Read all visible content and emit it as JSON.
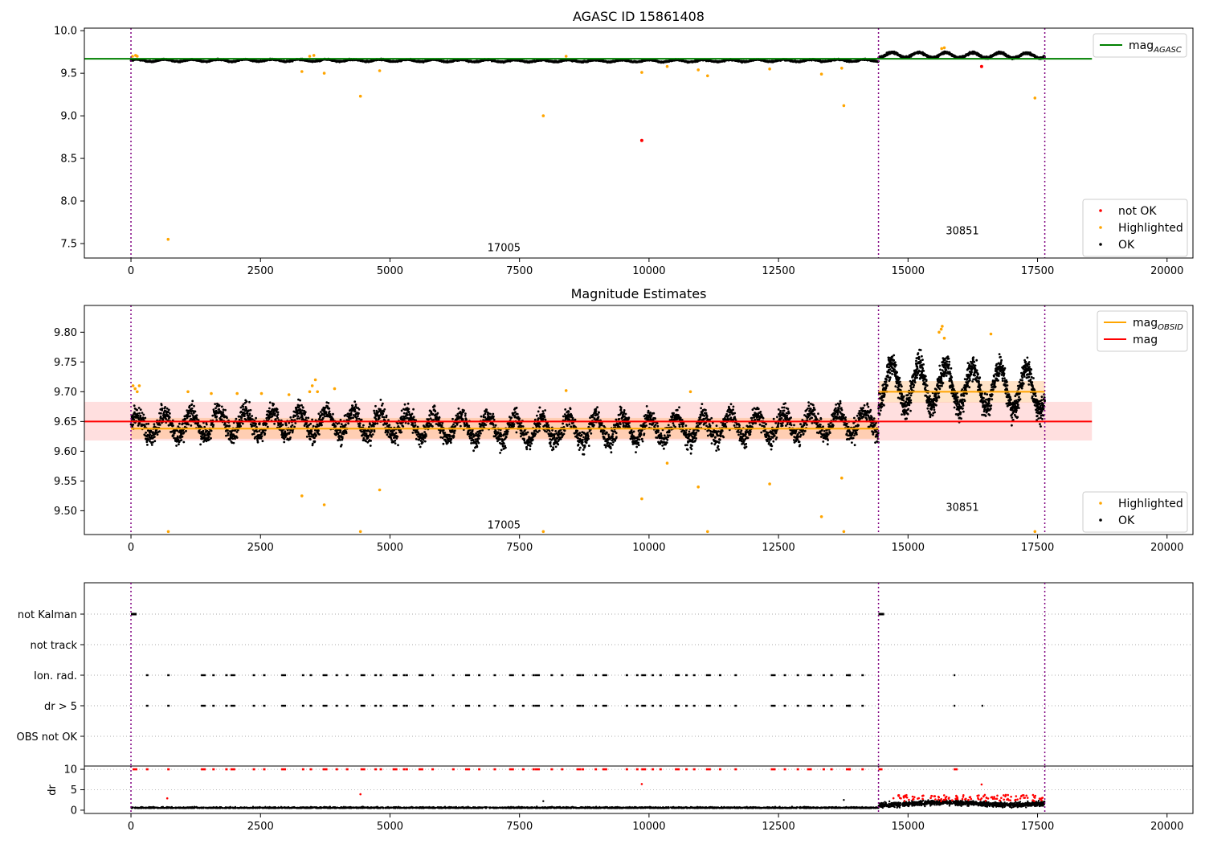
{
  "colors": {
    "ok": "#000000",
    "highlighted": "#ffa500",
    "not_ok": "#ff0000",
    "agasc_line": "#008000",
    "obsid_line": "#ffa500",
    "mag_line": "#ff0000",
    "boundary": "#800080",
    "band_red": "#ff8080",
    "band_orange": "#ffb060"
  },
  "chart_data": [
    {
      "type": "scatter",
      "title": "AGASC ID 15861408",
      "xlim": [
        -900,
        20500
      ],
      "ylim": [
        7.33,
        10.03
      ],
      "xticks": [
        0,
        2500,
        5000,
        7500,
        10000,
        12500,
        15000,
        17500,
        20000
      ],
      "yticks": [
        "7.5",
        "8.0",
        "8.5",
        "9.0",
        "9.5",
        "10.0"
      ],
      "ytick_values": [
        7.5,
        8.0,
        8.5,
        9.0,
        9.5,
        10.0
      ],
      "boundaries": [
        0,
        14430,
        17640
      ],
      "annotations": [
        {
          "text": "17005",
          "x": 7200,
          "y": 7.41
        },
        {
          "text": "30851",
          "x": 16050,
          "y": 7.61
        }
      ],
      "legend_top": [
        {
          "label": "mag",
          "sub": "AGASC",
          "kind": "line",
          "color": "#008000"
        }
      ],
      "legend_bottom": [
        {
          "label": "not OK",
          "color": "#ff0000"
        },
        {
          "label": "Highlighted",
          "color": "#ffa500"
        },
        {
          "label": "OK",
          "color": "#000000"
        }
      ],
      "reference_line": {
        "name": "mag_AGASC",
        "y": 9.67,
        "x": [
          -900,
          18550
        ]
      },
      "series": [
        {
          "name": "OK",
          "segments": [
            {
              "x": [
                0,
                14430
              ],
              "mean": 9.648,
              "amp": 0.012,
              "noise": 0.008
            },
            {
              "x": [
                14430,
                17640
              ],
              "mean": 9.705,
              "amp": 0.03,
              "noise": 0.012
            }
          ]
        },
        {
          "name": "Highlighted",
          "points": [
            [
              30,
              9.7
            ],
            [
              90,
              9.71
            ],
            [
              120,
              9.7
            ],
            [
              718,
              7.55
            ],
            [
              3300,
              9.52
            ],
            [
              3450,
              9.7
            ],
            [
              3530,
              9.71
            ],
            [
              3730,
              9.5
            ],
            [
              4430,
              9.23
            ],
            [
              4800,
              9.53
            ],
            [
              7960,
              9.0
            ],
            [
              8400,
              9.7
            ],
            [
              9860,
              9.51
            ],
            [
              10350,
              9.58
            ],
            [
              10950,
              9.54
            ],
            [
              11130,
              9.47
            ],
            [
              12330,
              9.55
            ],
            [
              13330,
              9.49
            ],
            [
              13720,
              9.56
            ],
            [
              13760,
              9.12
            ],
            [
              15650,
              9.79
            ],
            [
              15700,
              9.8
            ],
            [
              17450,
              9.21
            ]
          ]
        },
        {
          "name": "not OK",
          "points": [
            [
              9860,
              8.71
            ],
            [
              16420,
              9.58
            ]
          ]
        }
      ]
    },
    {
      "type": "scatter",
      "title": "Magnitude Estimates",
      "xlim": [
        -900,
        20500
      ],
      "ylim": [
        9.46,
        9.845
      ],
      "xticks": [
        0,
        2500,
        5000,
        7500,
        10000,
        12500,
        15000,
        17500,
        20000
      ],
      "yticks": [
        "9.50",
        "9.55",
        "9.60",
        "9.65",
        "9.70",
        "9.75",
        "9.80"
      ],
      "ytick_values": [
        9.5,
        9.55,
        9.6,
        9.65,
        9.7,
        9.75,
        9.8
      ],
      "boundaries": [
        0,
        14430,
        17640
      ],
      "annotations": [
        {
          "text": "17005",
          "x": 7200,
          "y": 9.47
        },
        {
          "text": "30851",
          "x": 16050,
          "y": 9.5
        }
      ],
      "legend_top": [
        {
          "label": "mag",
          "sub": "OBSID",
          "kind": "line",
          "color": "#ffa500"
        },
        {
          "label": "mag",
          "sub": "",
          "kind": "line",
          "color": "#ff0000"
        }
      ],
      "legend_bottom": [
        {
          "label": "Highlighted",
          "color": "#ffa500"
        },
        {
          "label": "OK",
          "color": "#000000"
        }
      ],
      "mag_line": {
        "y": 9.65,
        "x": [
          -900,
          18550
        ],
        "band": [
          9.618,
          9.683
        ]
      },
      "obsid_lines": [
        {
          "x": [
            0,
            14430
          ],
          "y": 9.638,
          "band": [
            9.621,
            9.656
          ]
        },
        {
          "x": [
            14430,
            17640
          ],
          "y": 9.7,
          "band": [
            9.682,
            9.718
          ]
        }
      ],
      "series": [
        {
          "name": "OK",
          "segments": [
            {
              "x": [
                0,
                14430
              ],
              "mean": 9.642,
              "amp": 0.02,
              "noise": 0.017
            },
            {
              "x": [
                14430,
                17640
              ],
              "mean": 9.7,
              "amp": 0.035,
              "noise": 0.02
            }
          ]
        },
        {
          "name": "Highlighted",
          "points": [
            [
              40,
              9.71
            ],
            [
              80,
              9.705
            ],
            [
              120,
              9.7
            ],
            [
              160,
              9.71
            ],
            [
              720,
              9.465
            ],
            [
              1100,
              9.7
            ],
            [
              1550,
              9.697
            ],
            [
              2050,
              9.697
            ],
            [
              2520,
              9.697
            ],
            [
              3050,
              9.695
            ],
            [
              3300,
              9.525
            ],
            [
              3450,
              9.7
            ],
            [
              3500,
              9.71
            ],
            [
              3560,
              9.72
            ],
            [
              3600,
              9.7
            ],
            [
              3730,
              9.51
            ],
            [
              3930,
              9.705
            ],
            [
              4430,
              9.465
            ],
            [
              4800,
              9.535
            ],
            [
              7960,
              9.465
            ],
            [
              8400,
              9.702
            ],
            [
              9860,
              9.52
            ],
            [
              10350,
              9.58
            ],
            [
              10800,
              9.7
            ],
            [
              10950,
              9.54
            ],
            [
              11130,
              9.465
            ],
            [
              12330,
              9.545
            ],
            [
              13330,
              9.49
            ],
            [
              13720,
              9.555
            ],
            [
              13760,
              9.465
            ],
            [
              15600,
              9.8
            ],
            [
              15640,
              9.805
            ],
            [
              15660,
              9.81
            ],
            [
              15700,
              9.79
            ],
            [
              16600,
              9.797
            ],
            [
              17450,
              9.465
            ]
          ]
        }
      ]
    },
    {
      "type": "scatter",
      "title": "",
      "xlim": [
        -900,
        20500
      ],
      "categories": [
        "not Kalman",
        "not track",
        "Ion. rad.",
        "dr > 5",
        "OBS not OK"
      ],
      "boundaries": [
        0,
        14430,
        17640
      ],
      "flag_clusters_x": [
        30,
        290,
        700,
        1350,
        1570,
        1820,
        1920,
        2350,
        2550,
        2900,
        3300,
        3450,
        3700,
        3950,
        4150,
        4430,
        4700,
        4800,
        5050,
        5250,
        5300,
        5550,
        5800,
        6200,
        6450,
        6700,
        7000,
        7300,
        7550,
        7750,
        7800,
        8100,
        8300,
        8600,
        8700,
        8950,
        9100,
        9550,
        9750,
        9850,
        10050,
        10200,
        10500,
        10700,
        10850,
        11100,
        11350,
        11650,
        12350,
        12600,
        12850,
        13050,
        13350,
        13500,
        13800,
        13850,
        14100,
        14430
      ],
      "kalman_x": [
        0,
        14430
      ]
    },
    {
      "type": "scatter",
      "title": "",
      "ylabel": "dr",
      "xlim": [
        -900,
        20500
      ],
      "ylim": [
        -0.8,
        10.8
      ],
      "xticks": [
        0,
        2500,
        5000,
        7500,
        10000,
        12500,
        15000,
        17500,
        20000
      ],
      "yticks": [
        "0",
        "5",
        "10"
      ],
      "ytick_values": [
        0,
        5,
        10
      ],
      "boundaries": [
        0,
        14430,
        17640
      ],
      "red_points_extra": [
        [
          700,
          2.9
        ],
        [
          4430,
          3.9
        ],
        [
          9860,
          6.4
        ],
        [
          16420,
          6.3
        ]
      ],
      "black_points_extra": [
        [
          7960,
          2.2
        ],
        [
          13760,
          2.5
        ]
      ]
    }
  ]
}
